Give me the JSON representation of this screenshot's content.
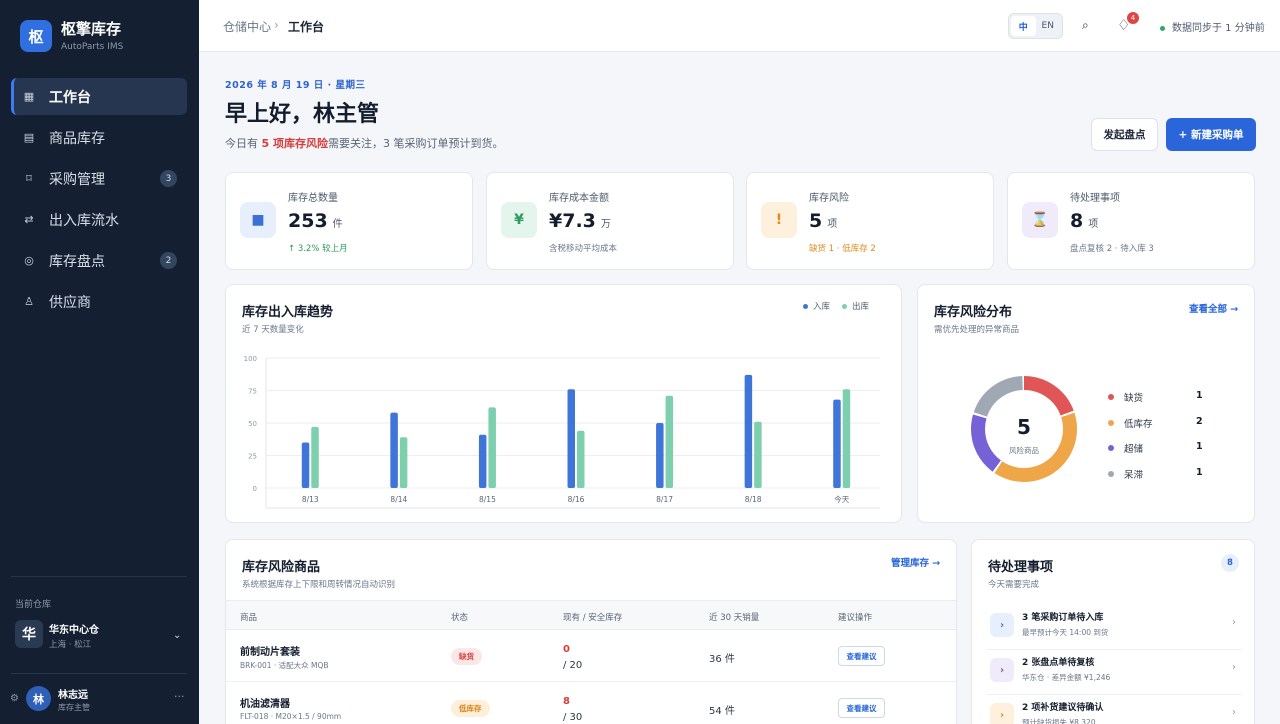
{
  "app": {
    "logo_char": "枢",
    "name": "枢擎库存",
    "subtitle": "AutoParts IMS"
  },
  "nav": [
    {
      "label": "工作台",
      "icon": "dashboard-icon",
      "glyph": "▦",
      "active": true,
      "badge": ""
    },
    {
      "label": "商品库存",
      "icon": "inventory-icon",
      "glyph": "▤",
      "active": false,
      "badge": ""
    },
    {
      "label": "采购管理",
      "icon": "purchase-icon",
      "glyph": "⌑",
      "active": false,
      "badge": "3"
    },
    {
      "label": "出入库流水",
      "icon": "transfer-icon",
      "glyph": "⇄",
      "active": false,
      "badge": ""
    },
    {
      "label": "库存盘点",
      "icon": "stocktake-icon",
      "glyph": "◎",
      "active": false,
      "badge": "2"
    },
    {
      "label": "供应商",
      "icon": "supplier-icon",
      "glyph": "♙",
      "active": false,
      "badge": ""
    }
  ],
  "warehouse": {
    "label": "当前仓库",
    "char": "华",
    "name": "华东中心仓",
    "location": "上海 · 松江"
  },
  "user": {
    "initial": "林",
    "name": "林志远",
    "role": "库存主管"
  },
  "topbar": {
    "crumb1": "仓储中心",
    "crumb2": "工作台",
    "lang_zh": "中",
    "lang_en": "EN",
    "notif_count": "4",
    "sync": "数据同步于 1 分钟前"
  },
  "header": {
    "date": "2026 年 8 月 19 日 · 星期三",
    "greeting": "早上好，林主管",
    "sub_pre": "今日有 ",
    "sub_risk": "5 项库存风险",
    "sub_post": "需要关注，3 笔采购订单预计到货。",
    "btn_stocktake": "发起盘点",
    "btn_new_po": "+ 新建采购单"
  },
  "stats": [
    {
      "label": "库存总数量",
      "value": "253",
      "unit": "件",
      "note": "↑ 3.2% 较上月",
      "glyph": "■",
      "icon": "box-icon",
      "bg": "#e8effc",
      "fg": "#3d6fd8",
      "note_color": "#2e9a5f"
    },
    {
      "label": "库存成本金额",
      "value": "¥7.3",
      "unit": "万",
      "note": "含税移动平均成本",
      "glyph": "¥",
      "icon": "yuan-icon",
      "bg": "#e3f5ec",
      "fg": "#2e9a5f",
      "note_color": "#6b778a"
    },
    {
      "label": "库存风险",
      "value": "5",
      "unit": "项",
      "note": "缺货 1 · 低库存 2",
      "glyph": "!",
      "icon": "warning-icon",
      "bg": "#fdf0dc",
      "fg": "#e08a1e",
      "note_color": "#e08a1e"
    },
    {
      "label": "待处理事项",
      "value": "8",
      "unit": "项",
      "note": "盘点复核 2 · 待入库 3",
      "glyph": "⌛",
      "icon": "hourglass-icon",
      "bg": "#efebfa",
      "fg": "#7257c9",
      "note_color": "#6b778a"
    }
  ],
  "trend": {
    "title": "库存出入库趋势",
    "subtitle": "近 7 天数量变化",
    "legend_in": "入库",
    "legend_out": "出库"
  },
  "chart_data": {
    "type": "bar",
    "categories": [
      "8/13",
      "8/14",
      "8/15",
      "8/16",
      "8/17",
      "8/18",
      "今天"
    ],
    "series": [
      {
        "name": "入库",
        "color": "#3f74d8",
        "values": [
          35,
          58,
          41,
          76,
          50,
          87,
          68
        ]
      },
      {
        "name": "出库",
        "color": "#7dcfae",
        "values": [
          47,
          39,
          62,
          44,
          71,
          51,
          76
        ]
      }
    ],
    "yticks": [
      0,
      25,
      50,
      75,
      100
    ],
    "ylim": [
      0,
      100
    ],
    "grid": true,
    "legend": "top-right"
  },
  "risk": {
    "title": "库存风险分布",
    "subtitle": "需优先处理的异常商品",
    "link": "查看全部 →",
    "total": "5",
    "total_label": "风险商品",
    "items": [
      {
        "name": "缺货",
        "count": "1",
        "color": "#e05555"
      },
      {
        "name": "低库存",
        "count": "2",
        "color": "#eea648"
      },
      {
        "name": "超储",
        "count": "1",
        "color": "#7661d6"
      },
      {
        "name": "呆滞",
        "count": "1",
        "color": "#a0a8b4"
      }
    ]
  },
  "table": {
    "title": "库存风险商品",
    "subtitle": "系统根据库存上下限和周转情况自动识别",
    "link": "管理库存 →",
    "headers": [
      "商品",
      "状态",
      "现有 / 安全库存",
      "近 30 天销量",
      "建议操作"
    ],
    "rows": [
      {
        "name": "前制动片套装",
        "spec": "BRK-001 · 适配大众 MQB",
        "status": "缺货",
        "status_bg": "#fde6e6",
        "status_fg": "#d93c3c",
        "current": "0",
        "safety": "/ 20",
        "sales": "36 件",
        "action": "查看建议"
      },
      {
        "name": "机油滤清器",
        "spec": "FLT-018 · M20×1.5 / 90mm",
        "status": "低库存",
        "status_bg": "#fdefd9",
        "status_fg": "#d88416",
        "current": "8",
        "safety": "/ 30",
        "sales": "54 件",
        "action": "查看建议"
      }
    ]
  },
  "todo": {
    "title": "待处理事项",
    "subtitle": "今天需要完成",
    "count": "8",
    "items": [
      {
        "title": "3 笔采购订单待入库",
        "desc": "最早预计今天 14:00 到货",
        "bg": "#e8effc",
        "fg": "#3d6fd8"
      },
      {
        "title": "2 张盘点单待复核",
        "desc": "华东仓 · 差异金额 ¥1,246",
        "bg": "#efebfa",
        "fg": "#7257c9"
      },
      {
        "title": "2 项补货建议待确认",
        "desc": "预计缺货损失 ¥8,320",
        "bg": "#fdf0dc",
        "fg": "#e08a1e"
      }
    ]
  }
}
